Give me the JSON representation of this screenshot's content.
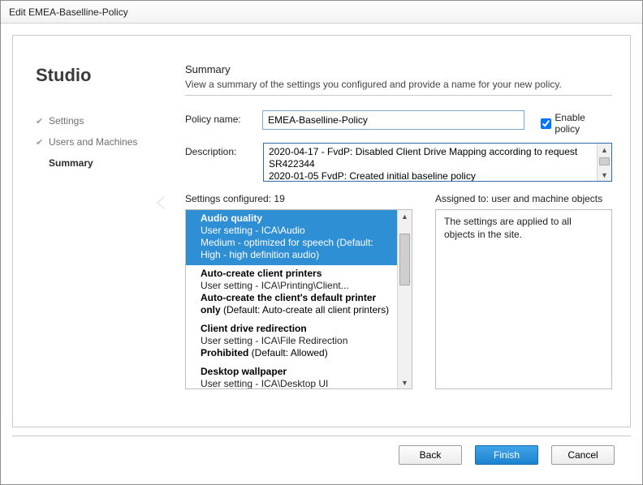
{
  "window": {
    "title": "Edit EMEA-Baselline-Policy"
  },
  "sidebar": {
    "brand": "Studio",
    "steps": [
      {
        "label": "Settings",
        "done": true,
        "active": false
      },
      {
        "label": "Users and Machines",
        "done": true,
        "active": false
      },
      {
        "label": "Summary",
        "done": false,
        "active": true
      }
    ]
  },
  "summary": {
    "heading": "Summary",
    "subtitle": "View a summary of the settings you configured and provide a name for your new policy.",
    "policy_name_label": "Policy name:",
    "policy_name_value": "EMEA-Baselline-Policy",
    "enable_label": "Enable policy",
    "enable_checked": true,
    "description_label": "Description:",
    "description_value": "2020-04-17 - FvdP: Disabled Client Drive Mapping according to request SR422344\n2020-01-05 FvdP: Created initial baseline policy"
  },
  "settings_list": {
    "heading": "Settings configured: 19",
    "items": [
      {
        "title": "Audio quality",
        "path": "User setting - ICA\\Audio",
        "value": "Medium - optimized for speech",
        "default_suffix": "(Default: High - high definition audio)",
        "selected": true
      },
      {
        "title": "Auto-create client printers",
        "path": "User setting - ICA\\Printing\\Client...",
        "value": "Auto-create the client's default printer only",
        "default_suffix": "(Default: Auto-create all client printers)",
        "selected": false
      },
      {
        "title": "Client drive redirection",
        "path": "User setting - ICA\\File Redirection",
        "value": "Prohibited",
        "default_suffix": "(Default: Allowed)",
        "selected": false
      },
      {
        "title": "Desktop wallpaper",
        "path": "User setting - ICA\\Desktop UI",
        "value": "",
        "default_suffix": "",
        "selected": false
      }
    ]
  },
  "assigned": {
    "heading": "Assigned to:  user and machine objects",
    "body": "The settings are applied to all objects in the site."
  },
  "buttons": {
    "back": "Back",
    "finish": "Finish",
    "cancel": "Cancel"
  }
}
